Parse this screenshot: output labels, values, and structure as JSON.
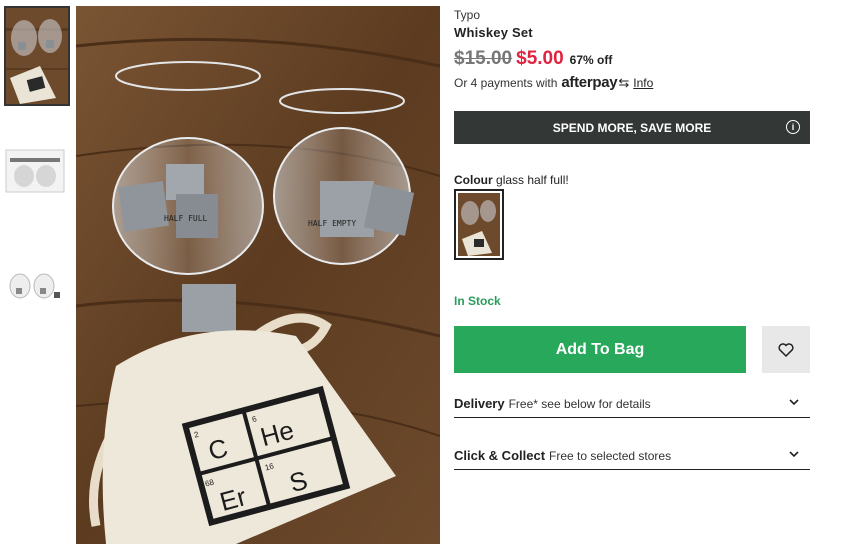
{
  "gallery": {
    "thumbnails": [
      {
        "name": "thumbnail-glasses-stones",
        "selected": true
      },
      {
        "name": "thumbnail-box-packaging",
        "selected": false
      },
      {
        "name": "thumbnail-glasses-white",
        "selected": false
      }
    ],
    "bag_text": {
      "c": "C",
      "he": "He",
      "er": "Er",
      "s": "S",
      "n2": "2",
      "n6": "6",
      "n68": "68",
      "n16": "16"
    },
    "glass_text": {
      "left": "HALF FULL",
      "right": "HALF EMPTY"
    }
  },
  "product": {
    "brand": "Typo",
    "title": "Whiskey Set",
    "price_was": "$15.00",
    "price_now": "$5.00",
    "discount": "67% off",
    "afterpay_prefix": "Or 4 payments with",
    "afterpay_logo": "afterpay",
    "afterpay_info": "Info"
  },
  "promo": {
    "label": "SPEND MORE, SAVE MORE",
    "icon": "info-icon"
  },
  "colour": {
    "label": "Colour",
    "value": "glass half full!"
  },
  "stock": {
    "status": "In Stock"
  },
  "actions": {
    "add_to_bag": "Add To Bag",
    "wishlist_icon": "heart-icon"
  },
  "accordions": [
    {
      "title": "Delivery",
      "subtitle": "Free* see below for details"
    },
    {
      "title": "Click & Collect",
      "subtitle": "Free to selected stores"
    }
  ],
  "colors": {
    "accent_green": "#27a85b",
    "sale_red": "#e0243f",
    "promo_bg": "#333837"
  }
}
